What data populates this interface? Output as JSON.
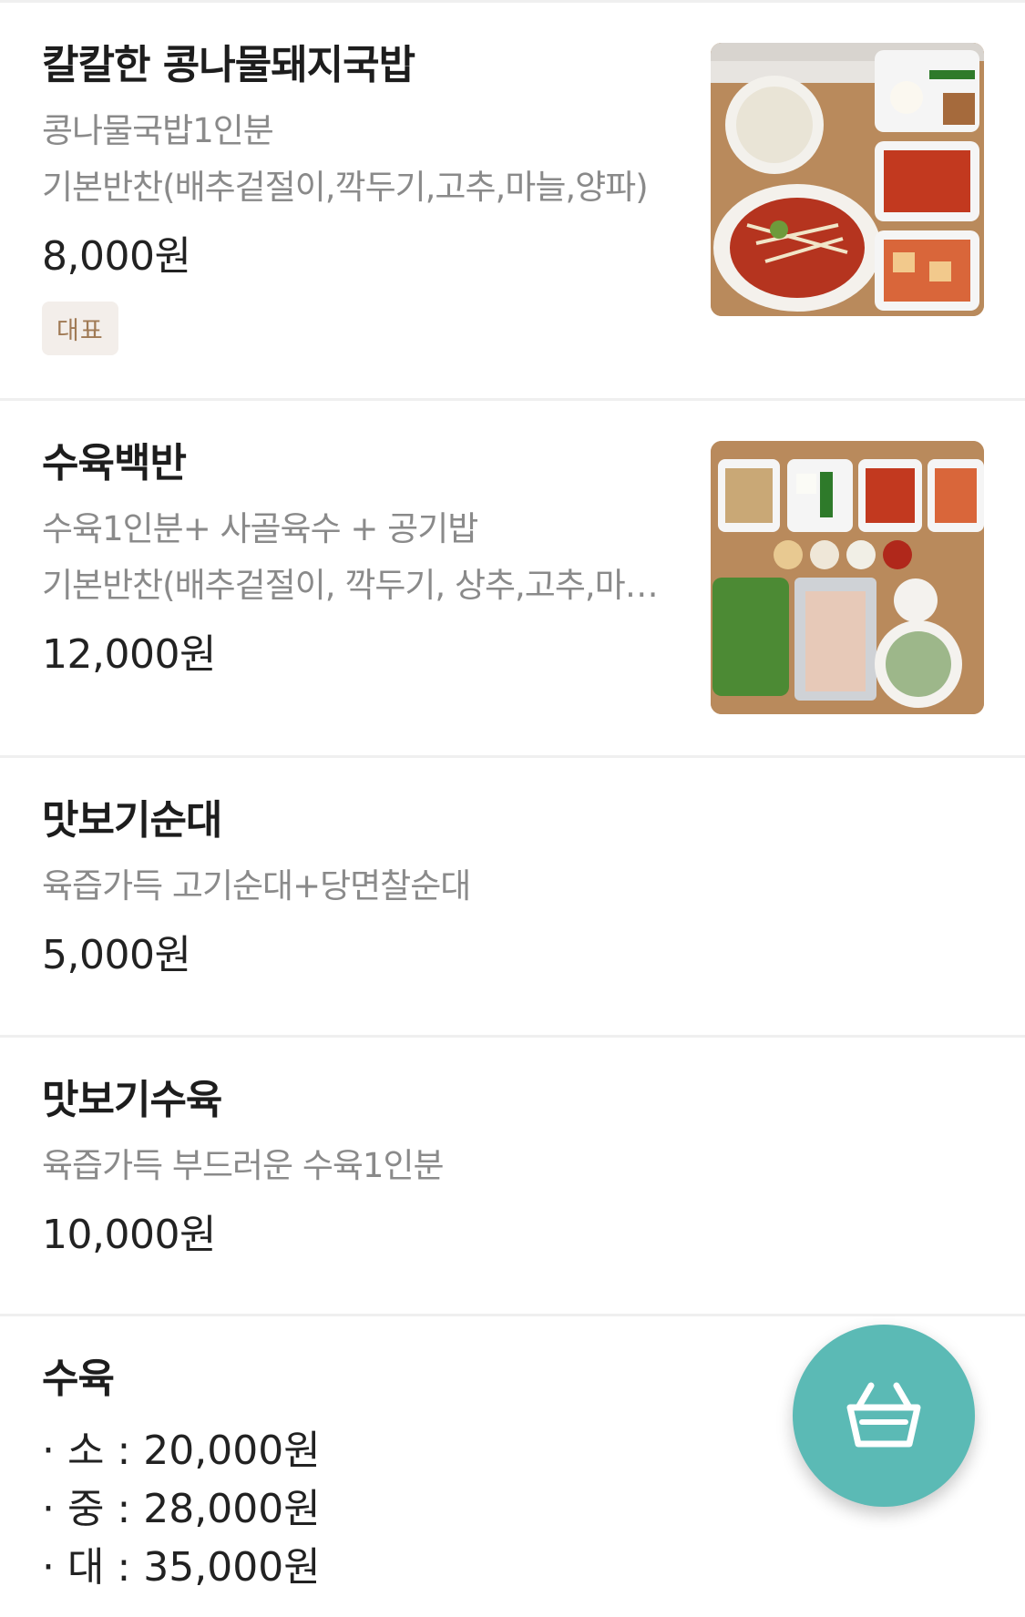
{
  "menu": {
    "items": [
      {
        "name": "칼칼한 콩나물돼지국밥",
        "desc_lines": [
          "콩나물국밥1인분",
          "기본반찬(배추겉절이,깍두기,고추,마늘,양파)"
        ],
        "price": "8,000원",
        "badge": "대표",
        "thumbnail": "kongnamul-gukbap-set-photo"
      },
      {
        "name": "수육백반",
        "desc_lines": [
          "수육1인분+ 사골육수 + 공기밥",
          "기본반찬(배추겉절이, 깍두기, 상추,고추,마늘)"
        ],
        "price": "12,000원",
        "thumbnail": "suyuk-baekban-set-photo"
      },
      {
        "name": "맛보기순대",
        "desc_lines": [
          "육즙가득 고기순대+당면찰순대"
        ],
        "price": "5,000원"
      },
      {
        "name": "맛보기수육",
        "desc_lines": [
          "육즙가득 부드러운 수육1인분"
        ],
        "price": "10,000원"
      },
      {
        "name": "수육",
        "sizes": [
          "· 소 : 20,000원",
          "· 중 : 28,000원",
          "· 대 : 35,000원"
        ]
      }
    ]
  },
  "cart_button": {
    "icon": "shopping-basket-icon",
    "color": "#5bbab5"
  }
}
